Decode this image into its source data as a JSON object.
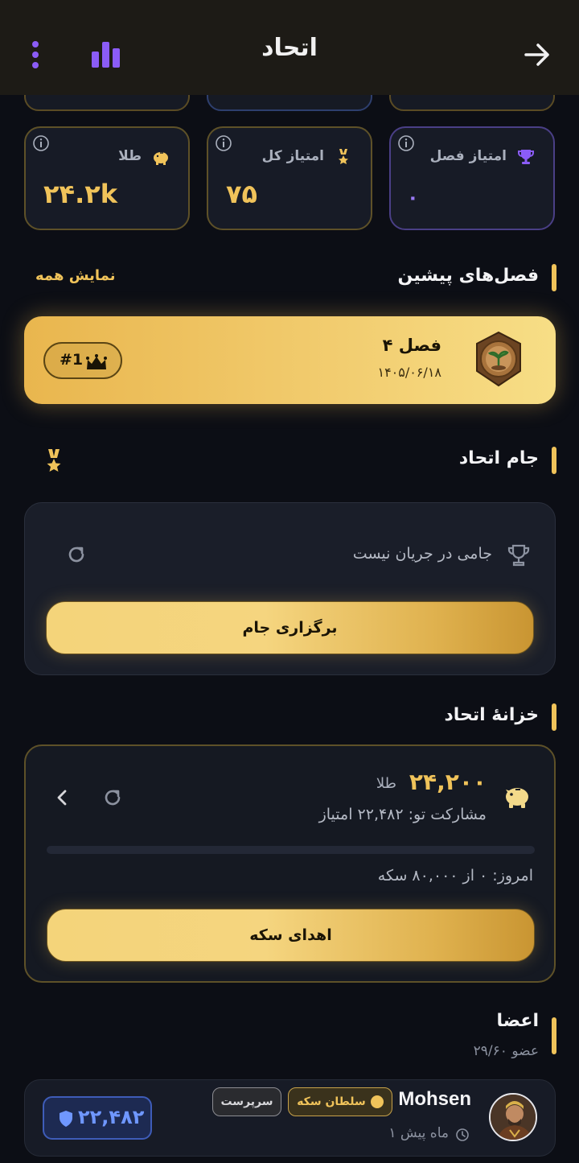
{
  "header": {
    "title": "اتحاد",
    "back_icon": "arrow-right-icon",
    "stats_icon": "bar-chart-icon",
    "menu_icon": "kebab-menu-icon"
  },
  "stats": [
    {
      "label": "امتیاز فصل",
      "value": "۰",
      "icon": "trophy-icon",
      "accent": "#9a7af5"
    },
    {
      "label": "امتیاز کل",
      "value": "۷۵",
      "icon": "medal-icon",
      "accent": "#f0c35a"
    },
    {
      "label": "طلا",
      "value": "۲۴.۲k",
      "icon": "piggy-bank-icon",
      "accent": "#f0c35a"
    }
  ],
  "previous_seasons": {
    "title": "فصل‌های پیشین",
    "show_all": "نمایش همه",
    "seasons": [
      {
        "name": "فصل ۴",
        "date": "۱۴۰۵/۰۶/۱۸",
        "rank": "#1"
      }
    ]
  },
  "cup": {
    "title": "جام اتحاد",
    "empty_text": "جامی در جریان نیست",
    "button": "برگزاری جام"
  },
  "treasury": {
    "title": "خزانهٔ اتحاد",
    "amount": "۲۴,۲۰۰",
    "amount_unit": "طلا",
    "contribution": "مشارکت تو: ۲۲,۴۸۲ امتیاز",
    "today": "امروز: ۰ از ۸۰,۰۰۰ سکه",
    "progress_fraction": 0,
    "button": "اهدای سکه"
  },
  "members": {
    "title": "اعضا",
    "count": "۲۹/۶۰ عضو",
    "list": [
      {
        "name": "Mohsen",
        "last_seen": "۱ ماه پیش",
        "badges": [
          "سلطان سکه",
          "سرپرست"
        ],
        "points": "۲۲,۴۸۲"
      }
    ]
  },
  "colors": {
    "gold": "#f0c35a",
    "purple": "#9a7af5",
    "blue": "#6f97ff",
    "background": "#0c0e15"
  }
}
